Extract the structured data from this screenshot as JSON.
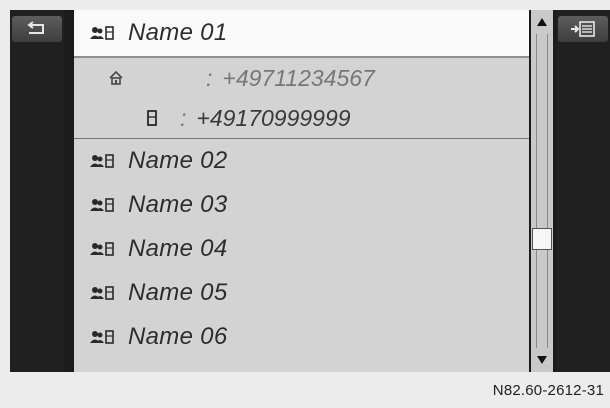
{
  "header": {
    "back_icon": "back-arrow-icon",
    "menu_icon": "list-menu-icon"
  },
  "selected_contact": {
    "name": "Name 01",
    "icon": "contact-phone-icon",
    "details": [
      {
        "type": "home",
        "icon": "home-icon",
        "separator": ":",
        "number": "+49711234567"
      },
      {
        "type": "mobile",
        "icon": "mobile-phone-icon",
        "separator": ":",
        "number": "+49170999999"
      }
    ]
  },
  "contacts": [
    {
      "name": "Name 02",
      "icon": "contact-phone-icon"
    },
    {
      "name": "Name 03",
      "icon": "contact-phone-icon"
    },
    {
      "name": "Name 04",
      "icon": "contact-phone-icon"
    },
    {
      "name": "Name 05",
      "icon": "contact-phone-icon"
    },
    {
      "name": "Name 06",
      "icon": "contact-phone-icon"
    }
  ],
  "scrollbar": {
    "up_icon": "scroll-up-arrow-icon",
    "down_icon": "scroll-down-arrow-icon"
  },
  "caption": "N82.60-2612-31",
  "colors": {
    "list_background": "#d3d3d3",
    "selected_background": "#fafafa",
    "side_panel": "#202020",
    "button": "#4a4a4a"
  }
}
